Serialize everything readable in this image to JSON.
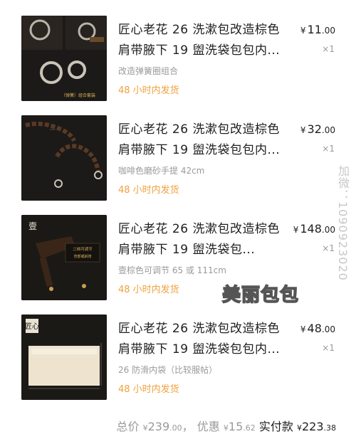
{
  "items": [
    {
      "title": "匠心老花 26 洗漱包改造棕色肩带腋下 19 盥洗袋包包内...",
      "price_currency": "¥",
      "price_int": "11",
      "price_dec": ".00",
      "quantity": "×1",
      "variant": "改造弹簧圈组合",
      "shipping": "48 小时内发货",
      "thumb_label": "（弹簧）组合套装",
      "thumb_icon": "spring-ring-icon"
    },
    {
      "title": "匠心老花 26 洗漱包改造棕色肩带腋下 19 盥洗袋包包内...",
      "price_currency": "¥",
      "price_int": "32",
      "price_dec": ".00",
      "quantity": "×1",
      "variant": "咖啡色磨砂手提 42cm",
      "shipping": "48 小时内发货",
      "thumb_label": "",
      "thumb_icon": "chain-strap-icon"
    },
    {
      "title": "匠心老花 26 洗漱包改造棕色肩带腋下 19 盥洗袋包...",
      "price_currency": "¥",
      "price_int": "148",
      "price_dec": ".00",
      "quantity": "×1",
      "variant": "壹棕色可调节 65 或 111cm",
      "shipping": "48 小时内发货",
      "thumb_label": "壹",
      "thumb_icon": "shoulder-strap-icon"
    },
    {
      "title": "匠心老花 26 洗漱包改造棕色肩带腋下 19 盥洗袋包包内...",
      "price_currency": "¥",
      "price_int": "48",
      "price_dec": ".00",
      "quantity": "×1",
      "variant": "26 防滑内袋（比较服帖）",
      "shipping": "48 小时内发货",
      "thumb_label": "匠心",
      "thumb_icon": "inner-bag-icon"
    }
  ],
  "footer": {
    "total_label": "总价",
    "total_cur": "¥",
    "total_int": "239",
    "total_dec": ".00",
    "sep": "，",
    "discount_label": "优惠",
    "discount_cur": "¥",
    "discount_int": "15",
    "discount_dec": ".62",
    "pay_label": "实付款",
    "pay_cur": "¥",
    "pay_int": "223",
    "pay_dec": ".38"
  },
  "watermark": {
    "contact": "加微：1090923020",
    "logo": "美丽包包"
  },
  "colors": {
    "shipping": "#f0a13c",
    "muted": "#9a9a9a",
    "text": "#1f1f1f"
  }
}
